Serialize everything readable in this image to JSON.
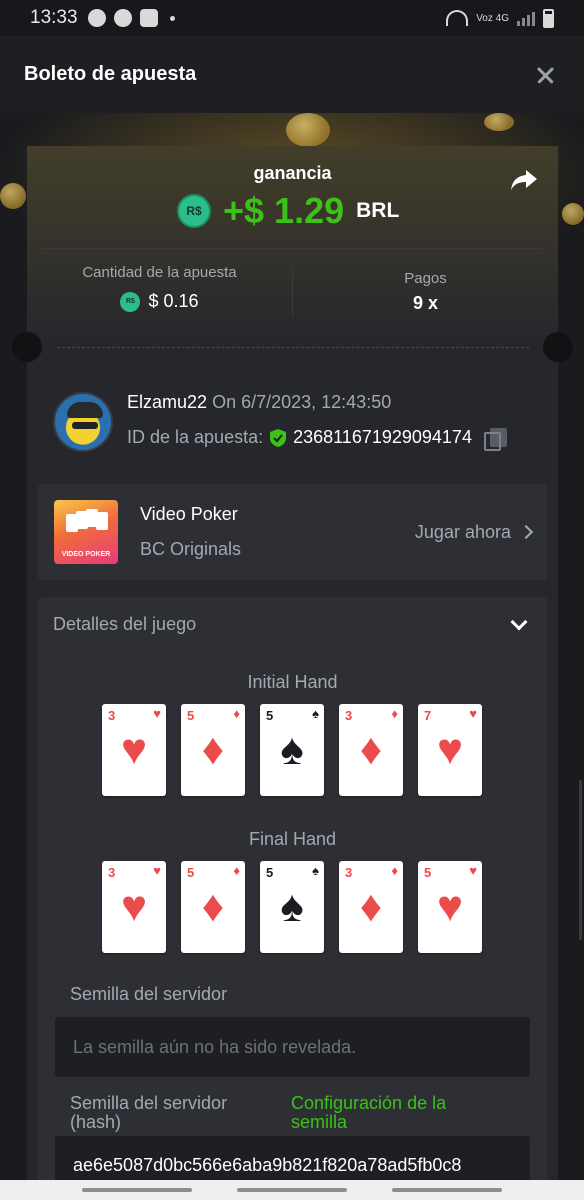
{
  "status_bar": {
    "time": "13:33",
    "network": "Voz 4G"
  },
  "header": {
    "title": "Boleto de apuesta"
  },
  "ticket": {
    "win_label": "ganancia",
    "currency_badge": "R$",
    "win_amount": "+$ 1.29",
    "win_currency": "BRL",
    "bet_amount_label": "Cantidad de la apuesta",
    "bet_amount": "$ 0.16",
    "payout_label": "Pagos",
    "payout": "9 x"
  },
  "user": {
    "name": "Elzamu22",
    "date": "On 6/7/2023, 12:43:50",
    "bet_id_label": "ID de la apuesta:",
    "bet_id": "236811671929094174"
  },
  "game": {
    "name": "Video Poker",
    "provider": "BC Originals",
    "thumb_label": "VIDEO POKER",
    "play_label": "Jugar ahora"
  },
  "details": {
    "title": "Detalles del juego",
    "initial_hand_label": "Initial Hand",
    "initial_hand": [
      {
        "rank": "3",
        "suit": "♥",
        "color": "red"
      },
      {
        "rank": "5",
        "suit": "♦",
        "color": "red"
      },
      {
        "rank": "5",
        "suit": "♠",
        "color": "black"
      },
      {
        "rank": "3",
        "suit": "♦",
        "color": "red"
      },
      {
        "rank": "7",
        "suit": "♥",
        "color": "red"
      }
    ],
    "final_hand_label": "Final Hand",
    "final_hand": [
      {
        "rank": "3",
        "suit": "♥",
        "color": "red"
      },
      {
        "rank": "5",
        "suit": "♦",
        "color": "red"
      },
      {
        "rank": "5",
        "suit": "♠",
        "color": "black"
      },
      {
        "rank": "3",
        "suit": "♦",
        "color": "red"
      },
      {
        "rank": "5",
        "suit": "♥",
        "color": "red"
      }
    ],
    "server_seed_label": "Semilla del servidor",
    "server_seed_placeholder": "La semilla aún no ha sido revelada.",
    "server_seed_hash_label": "Semilla del servidor (hash)",
    "seed_config_link": "Configuración de la semilla",
    "server_seed_hash": "ae6e5087d0bc566e6aba9b821f820a78ad5fb0c8"
  },
  "colors": {
    "win_green": "#3bc117",
    "badge_green": "#2bbd8a",
    "card_red": "#ec4b4b"
  }
}
